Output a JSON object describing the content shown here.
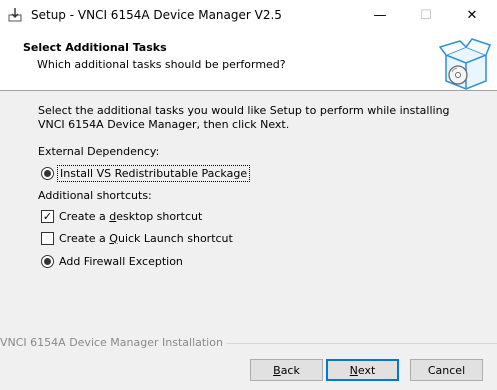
{
  "window": {
    "title": "Setup - VNCI 6154A Device Manager V2.5",
    "controls": {
      "minimize": "—",
      "maximize": "☐",
      "close": "✕"
    }
  },
  "header": {
    "title": "Select Additional Tasks",
    "subtitle": "Which additional tasks should be performed?"
  },
  "body": {
    "intro": "Select the additional tasks you would like Setup to perform while installing VNCI 6154A Device Manager, then click Next.",
    "external_dependency_label": "External Dependency:",
    "install_vs_label": "Install VS Redistributable Package",
    "install_vs_selected": true,
    "additional_shortcuts_label": "Additional shortcuts:",
    "desktop_shortcut": {
      "pre": "Create a ",
      "key": "d",
      "post": "esktop shortcut",
      "checked": true
    },
    "quick_launch": {
      "pre": "Create a ",
      "key": "Q",
      "post": "uick Launch shortcut",
      "checked": false
    },
    "firewall_label": "Add Firewall Exception",
    "firewall_selected": true
  },
  "footer": {
    "installation_label": "VNCI 6154A Device Manager Installation",
    "back": {
      "key": "B",
      "rest": "ack"
    },
    "next": {
      "key": "N",
      "rest": "ext"
    },
    "cancel_label": "Cancel"
  },
  "colors": {
    "accent": "#0078d7",
    "header_bg": "#ffffff",
    "body_bg": "#f0f0f0"
  },
  "icons": {
    "app": "installer-box-icon",
    "wizard": "software-box-disc-icon"
  }
}
